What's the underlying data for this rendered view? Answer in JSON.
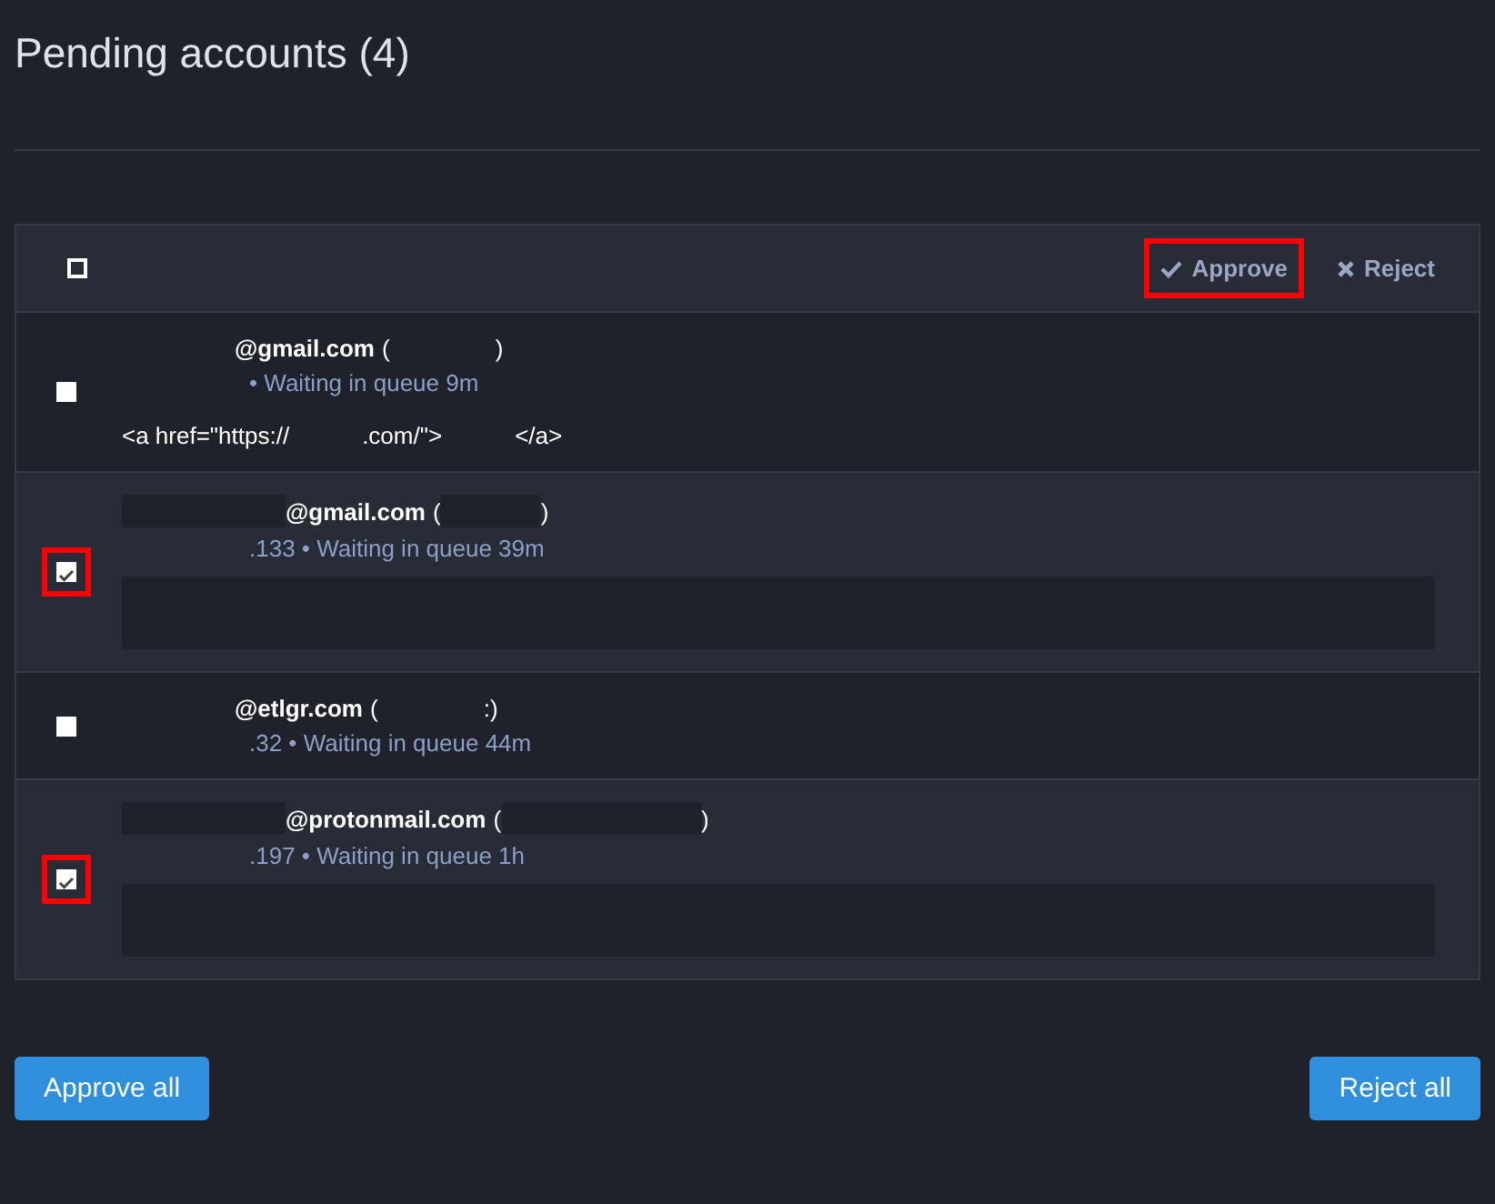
{
  "title": "Pending accounts (4)",
  "toolbar": {
    "select_all_checked": false,
    "approve": {
      "label": "Approve",
      "highlighted": true
    },
    "reject": {
      "label": "Reject",
      "highlighted": false
    }
  },
  "accounts": [
    {
      "checked": false,
      "highlighted": false,
      "name_redacted": false,
      "domain": "@gmail.com",
      "open": "(",
      "open_redacted": false,
      "close": ")",
      "meta": "• Waiting in queue 9m",
      "message": {
        "kind": "text",
        "parts": [
          "<a href=\"https://",
          ".com/\">",
          "</a>"
        ]
      }
    },
    {
      "checked": true,
      "highlighted": true,
      "name_redacted": true,
      "domain": "@gmail.com",
      "open": "(",
      "open_redacted": true,
      "close": ")",
      "meta": ".133 • Waiting in queue 39m",
      "message": {
        "kind": "redacted"
      }
    },
    {
      "checked": false,
      "highlighted": false,
      "name_redacted": false,
      "domain": "@etlgr.com",
      "open": "(",
      "open_redacted": false,
      "close": ":)",
      "meta": ".32 • Waiting in queue 44m"
    },
    {
      "checked": true,
      "highlighted": true,
      "name_redacted": true,
      "domain": "@protonmail.com",
      "open": "(",
      "open_redacted": true,
      "close": ")",
      "meta": ".197 • Waiting in queue 1h",
      "message": {
        "kind": "redacted"
      }
    }
  ],
  "footer": {
    "approve_all": "Approve all",
    "reject_all": "Reject all"
  }
}
